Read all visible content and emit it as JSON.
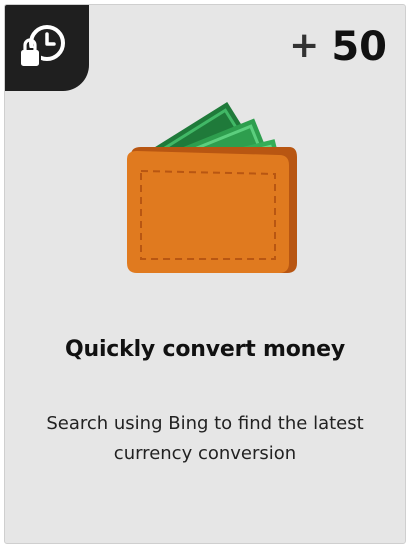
{
  "card": {
    "badge_icon": "lock-clock-icon",
    "points_prefix": "+",
    "points_value": "50",
    "illustration_icon": "wallet-with-cash-icon",
    "title": "Quickly convert money",
    "description": "Search using Bing to find the latest currency conversion"
  },
  "colors": {
    "card_background": "#e6e6e6",
    "badge_background": "#1f1f1f",
    "wallet_orange": "#e07a1f",
    "cash_green": "#2e9e4e"
  }
}
